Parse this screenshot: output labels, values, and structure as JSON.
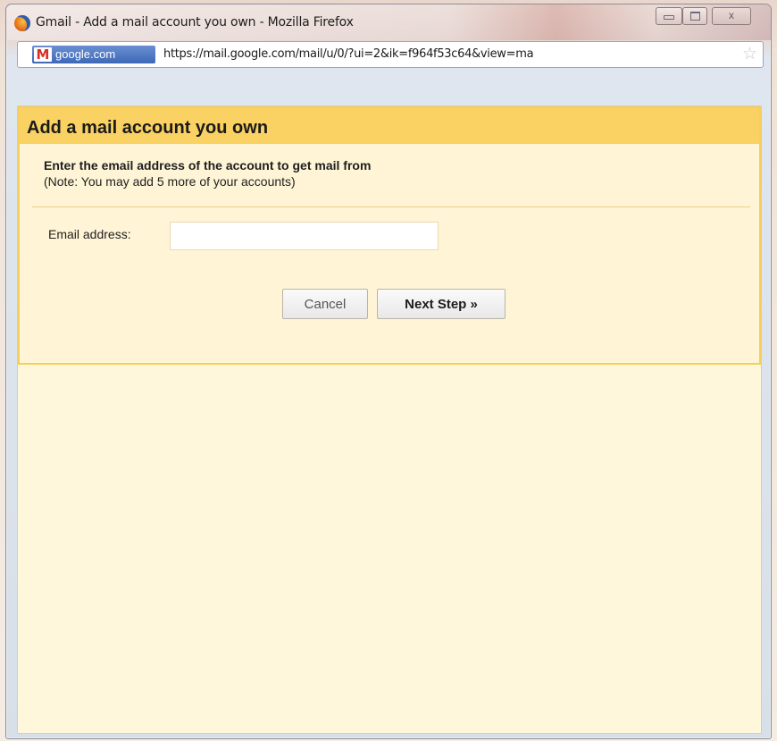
{
  "window": {
    "title": "Gmail - Add a mail account you own - Mozilla Firefox",
    "controls": {
      "minimize_icon": "minimize-icon",
      "maximize_icon": "maximize-icon",
      "close_label": "x"
    }
  },
  "addressbar": {
    "site_identity": "google.com",
    "url": "https://mail.google.com/mail/u/0/?ui=2&ik=f964f53c64&view=ma",
    "site_icon": "gmail-icon",
    "bookmark_icon": "star-icon"
  },
  "dialog": {
    "title": "Add a mail account you own",
    "instruction": "Enter the email address of the account to get mail from",
    "note": "(Note: You may add 5 more of your accounts)",
    "email_label": "Email address:",
    "email_value": "",
    "cancel_label": "Cancel",
    "next_label": "Next Step »"
  },
  "colors": {
    "header_bg": "#fad163",
    "panel_bg": "#fff5d6",
    "content_bg": "#fff7db"
  }
}
